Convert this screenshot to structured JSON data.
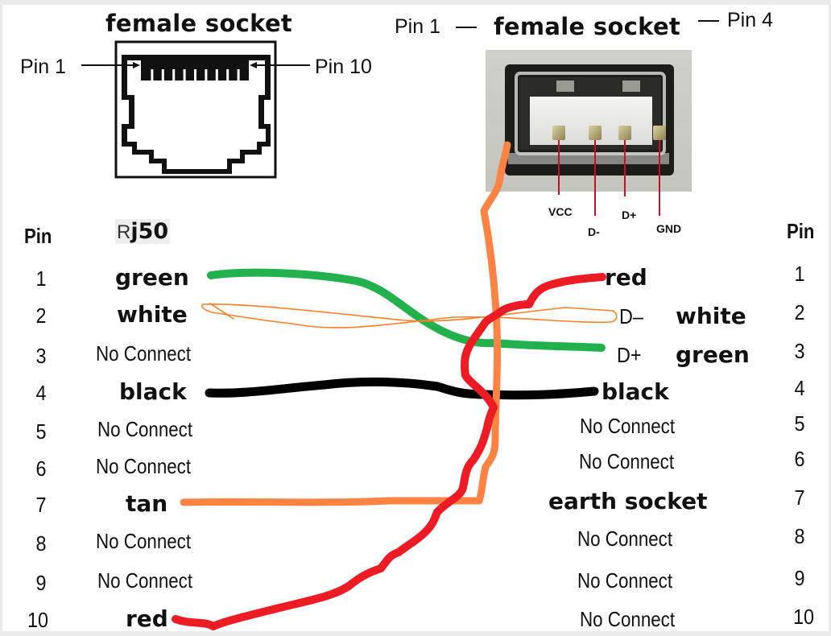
{
  "rj_socket": {
    "title": "female socket",
    "pin_first_label": "Pin 1",
    "pin_last_label": "Pin 10",
    "contact_count": 10
  },
  "usb_socket": {
    "title": "female socket",
    "pin_first_label": "Pin 1",
    "pin_last_label": "Pin 4",
    "contacts": [
      "VCC",
      "D-",
      "D+",
      "GND"
    ]
  },
  "left_table": {
    "pin_header": "Pin",
    "connector_header_prefix": "R",
    "connector_header": "j50",
    "rows": [
      {
        "pin": "1",
        "label": "green",
        "connected": true
      },
      {
        "pin": "2",
        "label": "white",
        "connected": true
      },
      {
        "pin": "3",
        "label": "No Connect",
        "connected": false
      },
      {
        "pin": "4",
        "label": "black",
        "connected": true
      },
      {
        "pin": "5",
        "label": "No Connect",
        "connected": false
      },
      {
        "pin": "6",
        "label": "No Connect",
        "connected": false
      },
      {
        "pin": "7",
        "label": "tan",
        "connected": true
      },
      {
        "pin": "8",
        "label": "No Connect",
        "connected": false
      },
      {
        "pin": "9",
        "label": "No Connect",
        "connected": false
      },
      {
        "pin": "10",
        "label": "red",
        "connected": true
      }
    ]
  },
  "right_table": {
    "pin_header": "Pin",
    "rows": [
      {
        "pin": "1",
        "label": "red",
        "signal": ""
      },
      {
        "pin": "2",
        "label": "white",
        "signal": "D–"
      },
      {
        "pin": "3",
        "label": "green",
        "signal": "D+"
      },
      {
        "pin": "4",
        "label": "black",
        "signal": ""
      },
      {
        "pin": "5",
        "label": "No Connect",
        "signal": ""
      },
      {
        "pin": "6",
        "label": "No Connect",
        "signal": ""
      },
      {
        "pin": "7",
        "label": "earth socket",
        "signal": ""
      },
      {
        "pin": "8",
        "label": "No Connect",
        "signal": ""
      },
      {
        "pin": "9",
        "label": "No Connect",
        "signal": ""
      },
      {
        "pin": "10",
        "label": "No Connect",
        "signal": ""
      }
    ]
  },
  "wires": [
    {
      "name": "green",
      "from_rj_pin": 1,
      "to": "D+ (USB pin 3)",
      "color": "#22b14c"
    },
    {
      "name": "white",
      "from_rj_pin": 2,
      "to": "D- (USB pin 2)",
      "color": "#ff7f27"
    },
    {
      "name": "black",
      "from_rj_pin": 4,
      "to": "GND (USB pin 4)",
      "color": "#000000"
    },
    {
      "name": "tan",
      "from_rj_pin": 7,
      "to": "earth socket (USB shell)",
      "color": "#ff8444"
    },
    {
      "name": "red",
      "from_rj_pin": 10,
      "to": "VCC (USB pin 1)",
      "color": "#ed1c24"
    }
  ]
}
